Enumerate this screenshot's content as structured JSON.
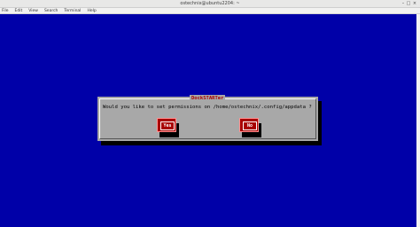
{
  "window": {
    "title": "ostechnix@ubuntu2204: ~"
  },
  "window_controls": {
    "minimize": "–",
    "maximize": "□",
    "close": "×"
  },
  "menubar": {
    "items": [
      {
        "label": "File"
      },
      {
        "label": "Edit"
      },
      {
        "label": "View"
      },
      {
        "label": "Search"
      },
      {
        "label": "Terminal"
      },
      {
        "label": "Help"
      }
    ]
  },
  "dialog": {
    "title": "DockSTARTer",
    "message": "Would you like to set permissions on /home/ostechnix/.config/appdata ?",
    "yes_label": "Yes",
    "no_label": "No"
  },
  "colors": {
    "terminal_bg": "#0000a8",
    "dialog_bg": "#a8a8a8",
    "button_bg": "#a80000",
    "title_text": "#a80000"
  }
}
